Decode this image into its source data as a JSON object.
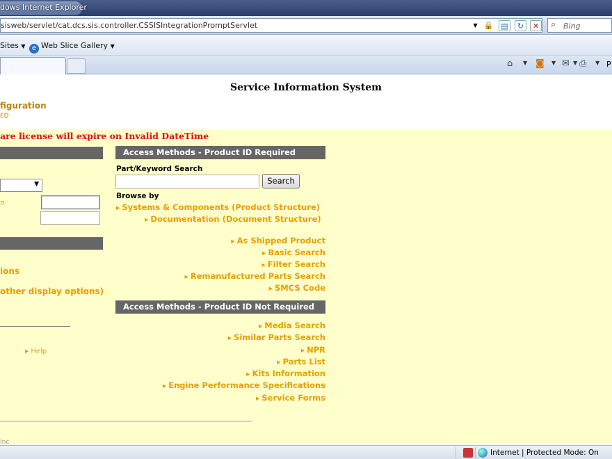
{
  "browser": {
    "title": "dows Internet Explorer",
    "address": "sisweb/servlet/cat.dcs.sis.controller.CSSISIntegrationPromptServlet",
    "search_placeholder": "Bing",
    "favorites": [
      "Sites",
      "Web Slice Gallery"
    ],
    "status": "Internet | Protected Mode: On",
    "command_last": "P"
  },
  "page": {
    "title": "Service Information System",
    "config_label": "figuration",
    "config_sub": "ED",
    "license_warning": "are license will expire on Invalid DateTime",
    "left": {
      "link_fragment": "n",
      "option1": "ions",
      "option2": "other display options)",
      "help": "Help",
      "copyright": "Inc"
    },
    "id_required": {
      "header": "Access Methods - Product ID Required",
      "search_label": "Part/Keyword Search",
      "search_button": "Search",
      "browse_label": "Browse by",
      "browse_links": [
        "Systems & Components (Product Structure)",
        "Documentation (Document Structure)"
      ],
      "links": [
        "As Shipped Product",
        "Basic Search",
        "Filter Search",
        "Remanufactured Parts Search",
        "SMCS Code"
      ]
    },
    "id_not_required": {
      "header": "Access Methods - Product ID Not Required",
      "links": [
        "Media Search",
        "Similar Parts Search",
        "NPR",
        "Parts List",
        "Kits Information",
        "Engine Performance Specifications",
        "Service Forms"
      ]
    }
  },
  "colors": {
    "link": "#e8a000",
    "warning": "#e01010",
    "page_bg": "#ffffcc",
    "bar": "#666666"
  }
}
